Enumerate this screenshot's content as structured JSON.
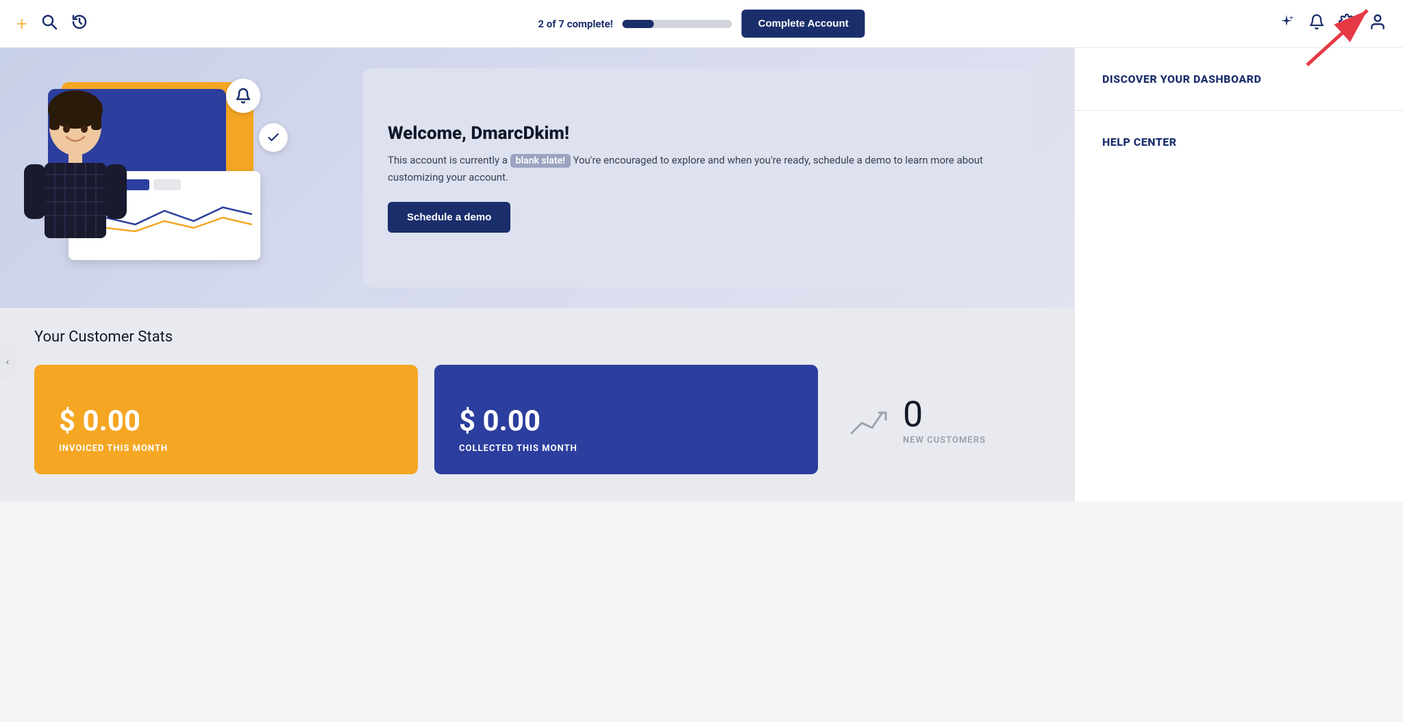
{
  "header": {
    "plus_label": "+",
    "progress_label": "2 of 7 complete!",
    "progress_percent": 28.5,
    "complete_account_label": "Complete Account",
    "icons": {
      "search": "🔍",
      "history": "↺",
      "sparkle": "✦",
      "bell": "🔔",
      "gear": "⚙",
      "user": "👤"
    }
  },
  "welcome": {
    "title": "Welcome, DmarcDkim!",
    "body_prefix": "This account is currently a ",
    "blank_slate_label": "blank slate!",
    "body_suffix": " You're encouraged to explore and when you're ready, schedule a demo to learn more about customizing your account.",
    "schedule_demo_label": "Schedule a demo"
  },
  "right_panel": {
    "items": [
      {
        "label": "DISCOVER YOUR DASHBOARD"
      },
      {
        "label": "HELP CENTER"
      }
    ]
  },
  "stats": {
    "section_title": "Your Customer Stats",
    "cards": [
      {
        "type": "orange",
        "amount": "$ 0.00",
        "label": "INVOICED THIS MONTH"
      },
      {
        "type": "blue",
        "amount": "$ 0.00",
        "label": "COLLECTED THIS MONTH"
      },
      {
        "type": "customers",
        "count": "0",
        "label": "NEW CUSTOMERS"
      }
    ]
  },
  "sidebar": {
    "collapse_icon": "‹"
  }
}
